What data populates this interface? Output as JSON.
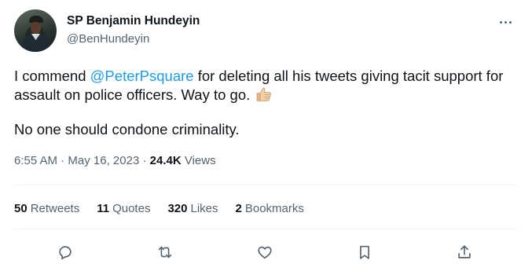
{
  "author": {
    "name": "SP Benjamin Hundeyin",
    "handle": "@BenHundeyin"
  },
  "tweet": {
    "text_before": "I commend ",
    "mention": "@PeterPsquare",
    "text_after": " for deleting all his tweets giving tacit support for assault on police officers. Way to go.",
    "emoji": "thumbs-up-icon",
    "line2": "No one should condone criminality."
  },
  "meta": {
    "time": "6:55 AM",
    "dot1": "·",
    "date": "May 16, 2023",
    "dot2": "·",
    "views_count": "24.4K",
    "views_label": "Views"
  },
  "stats": {
    "retweets_count": "50",
    "retweets_label": "Retweets",
    "quotes_count": "11",
    "quotes_label": "Quotes",
    "likes_count": "320",
    "likes_label": "Likes",
    "bookmarks_count": "2",
    "bookmarks_label": "Bookmarks"
  },
  "actions": [
    "reply-icon",
    "retweet-icon",
    "like-icon",
    "bookmark-icon",
    "share-icon"
  ],
  "colors": {
    "accent": "#1d9bf0",
    "text": "#0f1419",
    "muted": "#536471",
    "divider": "#eff3f4"
  }
}
